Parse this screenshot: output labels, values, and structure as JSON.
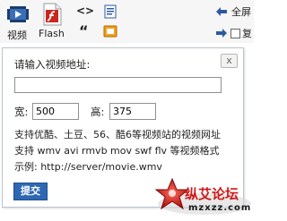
{
  "toolbar": {
    "video_label": "视频",
    "flash_label": "Flash",
    "fullscreen_label": "全屏",
    "code_glyph": "<>",
    "quote_glyph": "“",
    "fragment_label": "复"
  },
  "dialog": {
    "prompt": "请输入视频地址:",
    "close_glyph": "x",
    "url_value": "",
    "width_label": "宽:",
    "width_value": "500",
    "height_label": "高:",
    "height_value": "375",
    "info_line1": "支持优酷、土豆、56、酷6等视频站的视频网址",
    "info_line2": "支持 wmv avi rmvb mov swf flv 等视频格式",
    "info_line3": "示例: http://server/movie.wmv",
    "submit_label": "提交"
  },
  "watermark": {
    "brand_text": "纵艾论坛",
    "domain_text": "mzxzz.com"
  },
  "colors": {
    "submit_bg": "#2e68b4",
    "border": "#b9c3cf",
    "flash_red": "#c8281e"
  }
}
